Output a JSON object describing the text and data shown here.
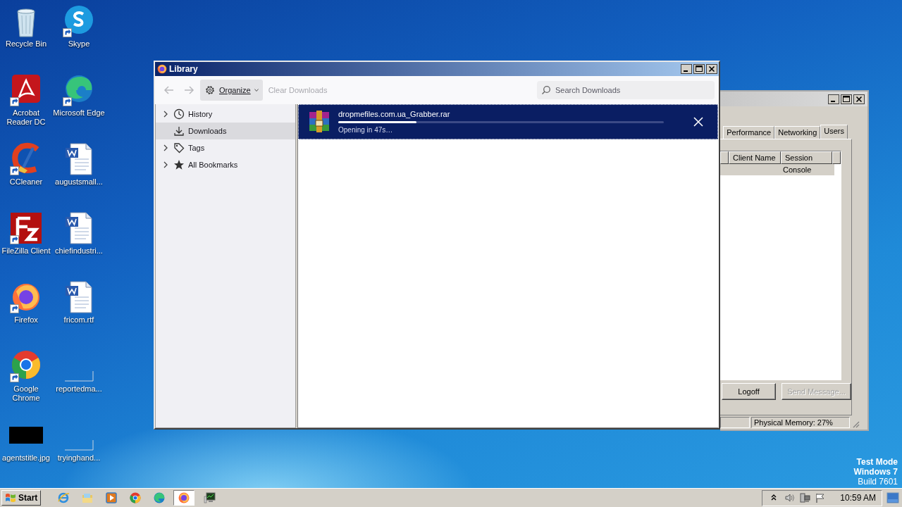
{
  "desktop_icons": [
    {
      "label": "Recycle Bin",
      "kind": "recycle",
      "shortcut": false
    },
    {
      "label": "Skype",
      "kind": "skype",
      "shortcut": true
    },
    {
      "label": "Acrobat Reader DC",
      "kind": "acrobat",
      "shortcut": true
    },
    {
      "label": "Microsoft Edge",
      "kind": "edge",
      "shortcut": true
    },
    {
      "label": "CCleaner",
      "kind": "ccleaner",
      "shortcut": true
    },
    {
      "label": "augustsmall...",
      "kind": "word",
      "shortcut": false
    },
    {
      "label": "FileZilla Client",
      "kind": "filezilla",
      "shortcut": true
    },
    {
      "label": "chiefindustri...",
      "kind": "word",
      "shortcut": false
    },
    {
      "label": "Firefox",
      "kind": "firefox",
      "shortcut": true
    },
    {
      "label": "fricom.rtf",
      "kind": "word",
      "shortcut": false
    },
    {
      "label": "Google Chrome",
      "kind": "chrome",
      "shortcut": true
    },
    {
      "label": "reportedma...",
      "kind": "blank",
      "shortcut": false
    },
    {
      "label": "agentstitle.jpg",
      "kind": "image",
      "shortcut": false
    },
    {
      "label": "tryinghand...",
      "kind": "blank",
      "shortcut": false
    }
  ],
  "task_manager": {
    "tabs": [
      {
        "label": "Performance",
        "selected": false
      },
      {
        "label": "Networking",
        "selected": false
      },
      {
        "label": "Users",
        "selected": true
      }
    ],
    "table": {
      "columns": [
        "Client Name",
        "Session"
      ],
      "rows": [
        {
          "session": "Console",
          "selected": true
        }
      ]
    },
    "buttons": [
      {
        "label": "Logoff",
        "disabled": false
      },
      {
        "label": "Send Message...",
        "disabled": true
      }
    ],
    "status_bar": [
      "Physical Memory: 27%"
    ]
  },
  "library": {
    "title": "Library",
    "toolbar": {
      "back": {
        "disabled": true
      },
      "forward": {
        "disabled": true
      },
      "organize": "Organize",
      "clear_downloads": {
        "label": "Clear Downloads",
        "disabled": true
      },
      "search": {
        "placeholder": "Search Downloads"
      }
    },
    "sidebar": {
      "items": [
        {
          "label": "History",
          "kind": "clock",
          "expandable": true,
          "selected": false
        },
        {
          "label": "Downloads",
          "kind": "download",
          "expandable": false,
          "selected": true
        },
        {
          "label": "Tags",
          "kind": "tag",
          "expandable": true,
          "selected": false
        },
        {
          "label": "All Bookmarks",
          "kind": "star",
          "expandable": true,
          "selected": false
        }
      ]
    },
    "downloads": [
      {
        "filename": "dropmefiles.com.ua_Grabber.rar",
        "status": "Opening in 47s…",
        "level": 0.24,
        "selected": true
      }
    ]
  },
  "system_notice": [
    "Test Mode",
    "Windows 7",
    "Build 7601"
  ],
  "taskbar": {
    "start": "Start",
    "apps": [
      {
        "kind": "ie",
        "active": false
      },
      {
        "kind": "explorer",
        "active": false
      },
      {
        "kind": "media",
        "active": false
      },
      {
        "kind": "chrome",
        "active": false
      },
      {
        "kind": "edge",
        "active": false
      },
      {
        "kind": "firefox",
        "active": true
      },
      {
        "kind": "taskmgr",
        "active": false
      }
    ],
    "tray": {
      "icons": [
        {
          "kind": "arrows"
        },
        {
          "kind": "speaker"
        },
        {
          "kind": "network"
        },
        {
          "kind": "flag"
        }
      ],
      "clock": "10:59 AM"
    }
  }
}
